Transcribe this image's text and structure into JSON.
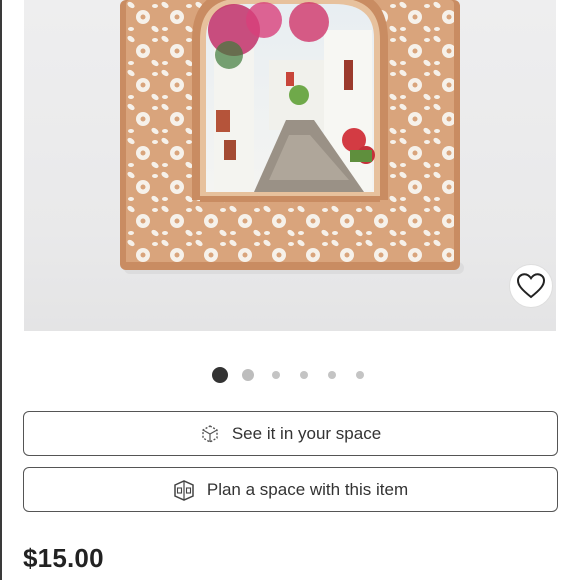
{
  "product": {
    "price": "$15.00"
  },
  "actions": {
    "see_it_label": "See it in your space",
    "plan_space_label": "Plan a space with this item"
  },
  "icons": {
    "favorite": "heart-outline-icon",
    "see_it": "ar-cube-icon",
    "plan_space": "room-planner-icon"
  },
  "carousel": {
    "total_images": 6,
    "active_index": 1
  },
  "colors": {
    "active_dot": "#333333",
    "inactive_dot": "#c4c4c4",
    "button_border": "#555555",
    "frame_wood": "#d9a47c"
  }
}
